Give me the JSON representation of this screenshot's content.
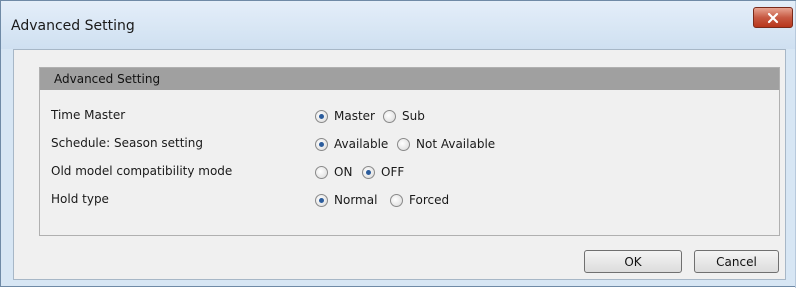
{
  "window": {
    "title": "Advanced Setting",
    "close_label": "x"
  },
  "group": {
    "title": "Advanced Setting"
  },
  "settings": [
    {
      "label": "Time Master",
      "options": [
        {
          "label": "Master",
          "selected": true
        },
        {
          "label": "Sub",
          "selected": false
        }
      ]
    },
    {
      "label": "Schedule: Season setting",
      "options": [
        {
          "label": "Available",
          "selected": true
        },
        {
          "label": "Not Available",
          "selected": false
        }
      ]
    },
    {
      "label": "Old model compatibility mode",
      "options": [
        {
          "label": "ON",
          "selected": false
        },
        {
          "label": "OFF",
          "selected": true
        }
      ]
    },
    {
      "label": "Hold type",
      "options": [
        {
          "label": "Normal",
          "selected": true
        },
        {
          "label": "Forced",
          "selected": false
        }
      ]
    }
  ],
  "buttons": {
    "ok": "OK",
    "cancel": "Cancel"
  },
  "colors": {
    "title_bar": "#d7e6f4",
    "close_button": "#c75a43",
    "group_header": "#a0a0a0",
    "radio_dot": "#2b5c9c"
  }
}
